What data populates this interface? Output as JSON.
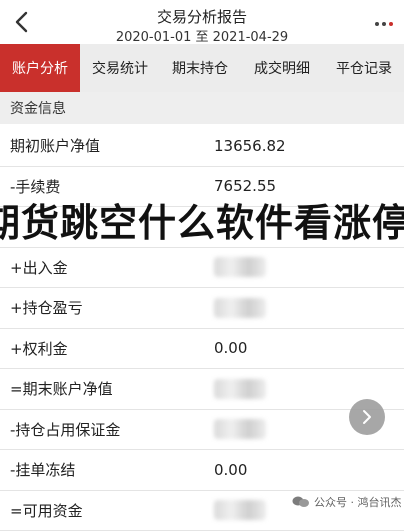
{
  "header": {
    "title": "交易分析报告",
    "subtitle": "2020-01-01 至 2021-04-29"
  },
  "tabs": [
    {
      "label": "账户分析",
      "active": true
    },
    {
      "label": "交易统计",
      "active": false
    },
    {
      "label": "期末持仓",
      "active": false
    },
    {
      "label": "成交明细",
      "active": false
    },
    {
      "label": "平仓记录",
      "active": false
    }
  ],
  "section": {
    "title": "资金信息"
  },
  "rows": [
    {
      "label": "期初账户净值",
      "value": "13656.82"
    },
    {
      "label": "-手续费",
      "value": "7652.55"
    },
    {
      "label": "",
      "value": ""
    },
    {
      "label": "+出入金",
      "value": ""
    },
    {
      "label": "+持仓盈亏",
      "value": ""
    },
    {
      "label": "+权利金",
      "value": "0.00"
    },
    {
      "label": "=期末账户净值",
      "value": ""
    },
    {
      "label": "-持仓占用保证金",
      "value": ""
    },
    {
      "label": "-挂单冻结",
      "value": "0.00"
    },
    {
      "label": "=可用资金",
      "value": ""
    }
  ],
  "banner": {
    "text": "期货跳空什么软件看涨停"
  },
  "watermark": {
    "text": "公众号 · 鸿台讯杰"
  },
  "colors": {
    "accent": "#c9302c",
    "tab_bg": "#ececec",
    "section_bg": "#eeeeee"
  },
  "icons": {
    "back": "chevron-left-icon",
    "more": "more-dots-icon",
    "next": "chevron-right-icon"
  }
}
